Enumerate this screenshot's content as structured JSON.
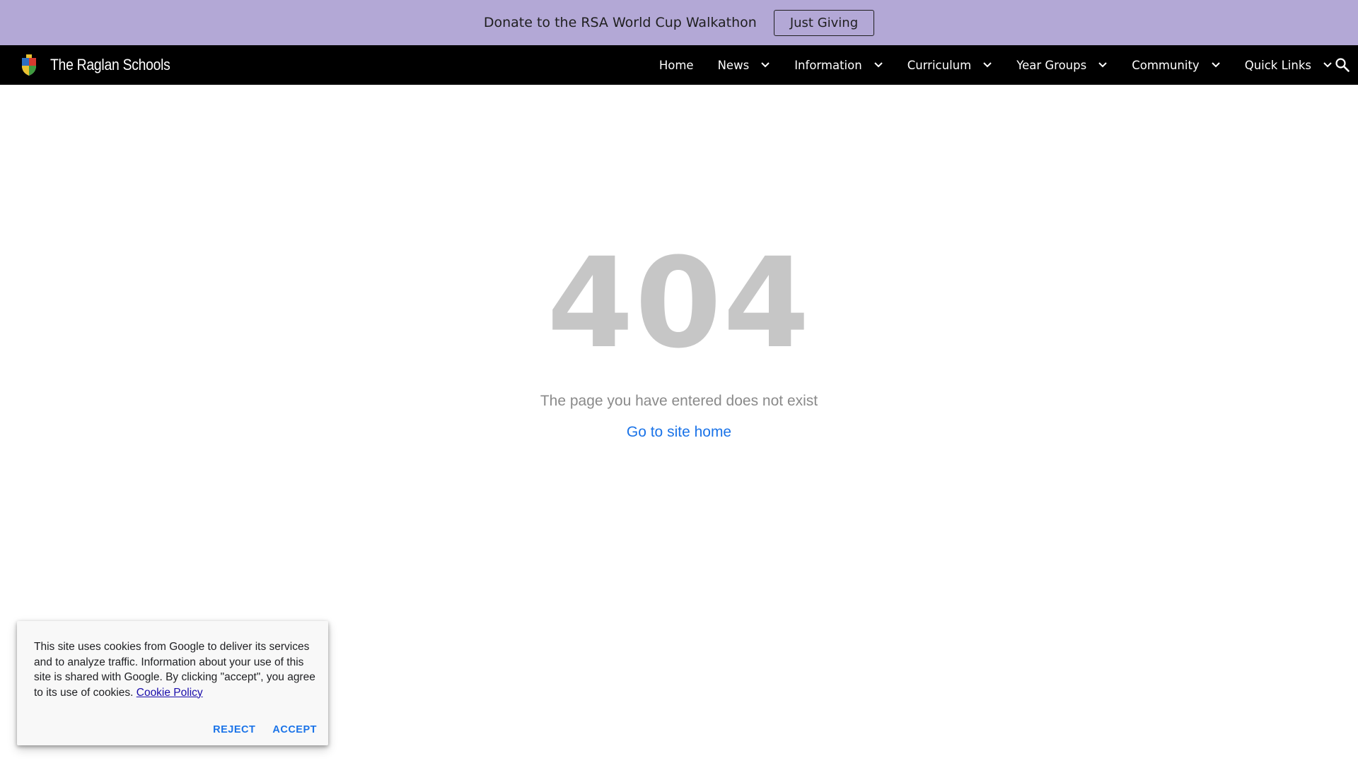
{
  "banner": {
    "text": "Donate to the RSA World Cup Walkathon",
    "button_label": "Just Giving"
  },
  "nav": {
    "site_title": "The Raglan Schools",
    "items": [
      {
        "label": "Home",
        "has_dropdown": false
      },
      {
        "label": "News",
        "has_dropdown": true
      },
      {
        "label": "Information",
        "has_dropdown": true
      },
      {
        "label": "Curriculum",
        "has_dropdown": true
      },
      {
        "label": "Year Groups",
        "has_dropdown": true
      },
      {
        "label": "Community",
        "has_dropdown": true
      },
      {
        "label": "Quick Links",
        "has_dropdown": true
      }
    ],
    "search_icon": "search-icon"
  },
  "main": {
    "error_code": "404",
    "message": "The page you have entered does not exist",
    "home_link": "Go to site home"
  },
  "cookie": {
    "text": "This site uses cookies from Google to deliver its services and to analyze traffic. Information about your use of this site is shared with Google. By clicking \"accept\", you agree to its use of cookies.",
    "policy_link": "Cookie Policy",
    "reject_label": "REJECT",
    "accept_label": "ACCEPT"
  },
  "colors": {
    "banner_bg": "#b3a8d6",
    "nav_bg": "#000000",
    "error_code": "#c6c6c6",
    "link": "#1a73e8"
  }
}
